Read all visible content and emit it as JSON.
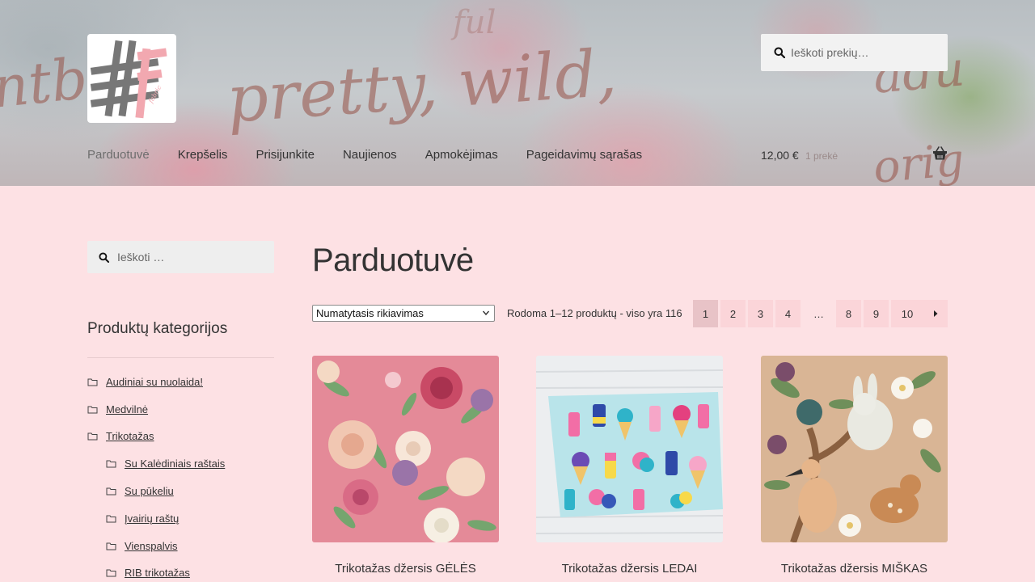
{
  "colors": {
    "page_bg": "#fde1e4",
    "pager_bg": "#fbd5d9",
    "pager_current_bg": "#e8c3c7",
    "logo_gray": "#777777",
    "logo_pink": "#f2a8b0"
  },
  "header": {
    "logo_caption": "fabric",
    "search": {
      "placeholder": "Ieškoti prekių…"
    },
    "nav": [
      {
        "label": "Parduotuvė",
        "active": true
      },
      {
        "label": "Krepšelis"
      },
      {
        "label": "Prisijunkite"
      },
      {
        "label": "Naujienos"
      },
      {
        "label": "Apmokėjimas"
      },
      {
        "label": "Pageidavimų sąrašas"
      }
    ],
    "cart": {
      "total": "12,00 €",
      "count": "1 prekė",
      "icon": "basket-icon"
    }
  },
  "sidebar": {
    "search": {
      "placeholder": "Ieškoti …"
    },
    "categories_title": "Produktų kategorijos",
    "categories": [
      {
        "label": "Audiniai su nuolaida!",
        "level": 0
      },
      {
        "label": "Medvilnė",
        "level": 0
      },
      {
        "label": "Trikotažas",
        "level": 0
      },
      {
        "label": "Su Kalėdiniais raštais",
        "level": 1
      },
      {
        "label": "Su pūkeliu",
        "level": 1
      },
      {
        "label": "Įvairių raštų",
        "level": 1
      },
      {
        "label": "Vienspalvis",
        "level": 1
      },
      {
        "label": "RIB trikotažas",
        "level": 1
      }
    ]
  },
  "main": {
    "title": "Parduotuvė",
    "sort": {
      "selected": "Numatytasis rikiavimas"
    },
    "result_count": "Rodoma 1–12 produktų - viso yra 116",
    "pagination": [
      "1",
      "2",
      "3",
      "4",
      "…",
      "8",
      "9",
      "10"
    ],
    "current_page": "1",
    "products": [
      {
        "title": "Trikotažas džersis GĖLĖS"
      },
      {
        "title": "Trikotažas džersis LEDAI"
      },
      {
        "title": "Trikotažas džersis MIŠKAS"
      }
    ]
  }
}
